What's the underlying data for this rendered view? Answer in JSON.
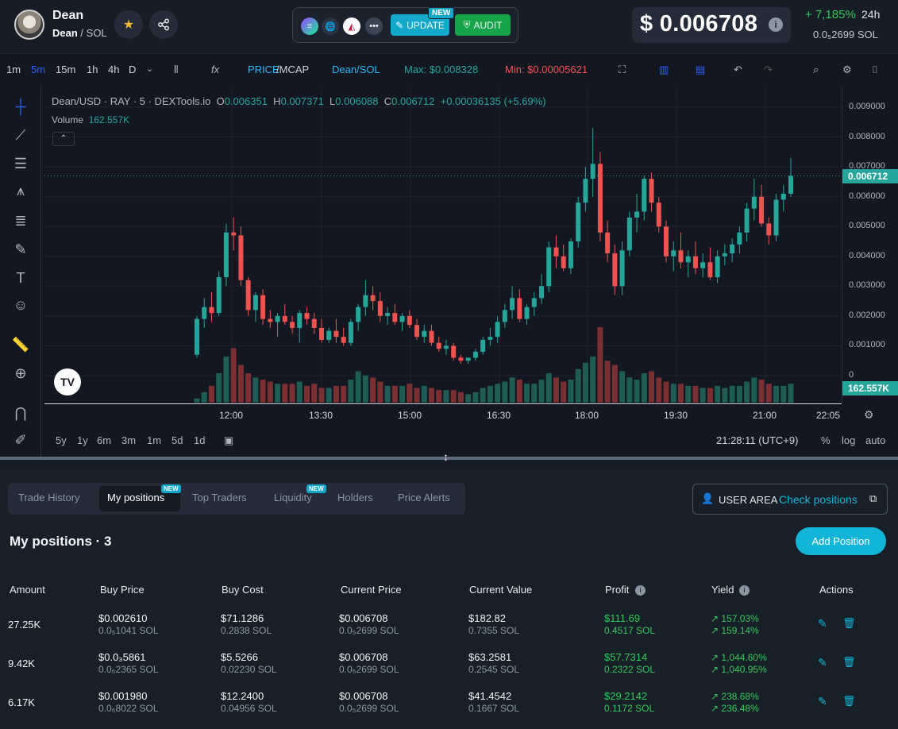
{
  "header": {
    "token_name": "Dean",
    "token_symbol": "Dean",
    "pair_quote": "/ SOL",
    "update_label": "UPDATE",
    "update_badge": "NEW",
    "audit_label": "AUDIT",
    "price": "$ 0.006708",
    "change": "+ 7,185%",
    "change_period": "24h",
    "price_sol": "0.0₅2699 SOL"
  },
  "toolbar": {
    "intervals": [
      "1m",
      "5m",
      "15m",
      "1h",
      "4h",
      "D"
    ],
    "active_interval": "5m",
    "price_label": "PRICE",
    "mcap_label": "/MCAP",
    "pair_label": "Dean/SOL",
    "max_label": "Max: $0.008328",
    "min_label": "Min: $0.00005621"
  },
  "legend": {
    "symbol": "Dean/USD · RAY · 5 · DEXTools.io",
    "o": "0.006351",
    "h": "0.007371",
    "l": "0.006088",
    "c": "0.006712",
    "change": "+0.00036135 (+5.69%)",
    "volume_label": "Volume",
    "volume_value": "162.557K"
  },
  "chart_data": {
    "type": "candlestick",
    "title": "Dean/USD · RAY · 5 · DEXTools.io",
    "y_ticks": [
      "0.009000",
      "0.008000",
      "0.007000",
      "0.006000",
      "0.005000",
      "0.004000",
      "0.003000",
      "0.002000",
      "0.001000",
      "0"
    ],
    "x_ticks": [
      "12:00",
      "13:30",
      "15:00",
      "16:30",
      "18:00",
      "19:30",
      "21:00",
      "22:05"
    ],
    "ylim": [
      0,
      0.0095
    ],
    "current_price_label": "0.006712",
    "current_volume_label": "162.557K",
    "series": [
      {
        "name": "Candles",
        "ohlc": [
          [
            0.0007,
            0.002,
            0.0006,
            0.0019
          ],
          [
            0.0019,
            0.0026,
            0.0016,
            0.0023
          ],
          [
            0.0023,
            0.0028,
            0.0018,
            0.0021
          ],
          [
            0.0021,
            0.0035,
            0.002,
            0.0033
          ],
          [
            0.0033,
            0.0051,
            0.003,
            0.0048
          ],
          [
            0.0048,
            0.0053,
            0.0042,
            0.0047
          ],
          [
            0.0047,
            0.005,
            0.003,
            0.0032
          ],
          [
            0.0032,
            0.0033,
            0.002,
            0.0022
          ],
          [
            0.0022,
            0.0028,
            0.0018,
            0.0027
          ],
          [
            0.0027,
            0.0029,
            0.0017,
            0.0019
          ],
          [
            0.0019,
            0.0022,
            0.0016,
            0.0018
          ],
          [
            0.0018,
            0.0021,
            0.0013,
            0.002
          ],
          [
            0.002,
            0.0024,
            0.0017,
            0.0018
          ],
          [
            0.0018,
            0.002,
            0.0014,
            0.0016
          ],
          [
            0.0016,
            0.0022,
            0.0011,
            0.0021
          ],
          [
            0.0021,
            0.0023,
            0.0017,
            0.0019
          ],
          [
            0.0019,
            0.0021,
            0.0014,
            0.0016
          ],
          [
            0.0016,
            0.0019,
            0.0011,
            0.0012
          ],
          [
            0.0012,
            0.0016,
            0.0011,
            0.0015
          ],
          [
            0.0015,
            0.0019,
            0.0011,
            0.0013
          ],
          [
            0.0013,
            0.0016,
            0.001,
            0.0011
          ],
          [
            0.0011,
            0.0019,
            0.001,
            0.0018
          ],
          [
            0.0018,
            0.0024,
            0.0015,
            0.0023
          ],
          [
            0.0023,
            0.0032,
            0.002,
            0.0027
          ],
          [
            0.0027,
            0.003,
            0.0022,
            0.0025
          ],
          [
            0.0025,
            0.0028,
            0.0018,
            0.002
          ],
          [
            0.002,
            0.0023,
            0.0017,
            0.0021
          ],
          [
            0.0021,
            0.0024,
            0.0017,
            0.0018
          ],
          [
            0.0018,
            0.0021,
            0.0015,
            0.002
          ],
          [
            0.002,
            0.0022,
            0.0016,
            0.0017
          ],
          [
            0.0017,
            0.0019,
            0.0012,
            0.0013
          ],
          [
            0.0013,
            0.0017,
            0.0011,
            0.0015
          ],
          [
            0.0015,
            0.0017,
            0.001,
            0.0011
          ],
          [
            0.0011,
            0.0013,
            0.0008,
            0.0009
          ],
          [
            0.0009,
            0.0012,
            0.0007,
            0.001
          ],
          [
            0.001,
            0.0011,
            0.0005,
            0.0006
          ],
          [
            0.0006,
            0.0007,
            0.0004,
            0.0005
          ],
          [
            0.0005,
            0.0006,
            0.0004,
            0.0006
          ],
          [
            0.0006,
            0.0009,
            0.0005,
            0.0008
          ],
          [
            0.0008,
            0.0013,
            0.0007,
            0.0012
          ],
          [
            0.0012,
            0.0016,
            0.001,
            0.0013
          ],
          [
            0.0013,
            0.002,
            0.0011,
            0.0018
          ],
          [
            0.0018,
            0.0024,
            0.0016,
            0.0022
          ],
          [
            0.0022,
            0.003,
            0.0019,
            0.0026
          ],
          [
            0.0026,
            0.0029,
            0.0018,
            0.0019
          ],
          [
            0.0019,
            0.0024,
            0.0017,
            0.0023
          ],
          [
            0.0023,
            0.0028,
            0.002,
            0.0026
          ],
          [
            0.0026,
            0.0034,
            0.0024,
            0.003
          ],
          [
            0.003,
            0.0045,
            0.0028,
            0.0043
          ],
          [
            0.0043,
            0.0047,
            0.0036,
            0.004
          ],
          [
            0.004,
            0.0044,
            0.0035,
            0.0036
          ],
          [
            0.0036,
            0.0046,
            0.0034,
            0.0045
          ],
          [
            0.0045,
            0.006,
            0.0043,
            0.0058
          ],
          [
            0.0058,
            0.007,
            0.0055,
            0.0066
          ],
          [
            0.0066,
            0.0083,
            0.006,
            0.0071
          ],
          [
            0.0071,
            0.0075,
            0.0045,
            0.0048
          ],
          [
            0.0048,
            0.0052,
            0.0038,
            0.0041
          ],
          [
            0.0041,
            0.0044,
            0.0027,
            0.003
          ],
          [
            0.003,
            0.0045,
            0.0027,
            0.0042
          ],
          [
            0.0042,
            0.0055,
            0.004,
            0.0053
          ],
          [
            0.0053,
            0.0061,
            0.0048,
            0.0055
          ],
          [
            0.0055,
            0.0067,
            0.0052,
            0.0066
          ],
          [
            0.0066,
            0.0068,
            0.0055,
            0.0058
          ],
          [
            0.0058,
            0.006,
            0.0048,
            0.005
          ],
          [
            0.005,
            0.0052,
            0.0038,
            0.004
          ],
          [
            0.004,
            0.0045,
            0.0035,
            0.0042
          ],
          [
            0.0042,
            0.0048,
            0.0036,
            0.0038
          ],
          [
            0.0038,
            0.0042,
            0.0033,
            0.004
          ],
          [
            0.004,
            0.0045,
            0.0034,
            0.0036
          ],
          [
            0.0036,
            0.0041,
            0.0033,
            0.0038
          ],
          [
            0.0038,
            0.0043,
            0.0032,
            0.0033
          ],
          [
            0.0033,
            0.0042,
            0.0031,
            0.004
          ],
          [
            0.004,
            0.0044,
            0.0037,
            0.0041
          ],
          [
            0.0041,
            0.0046,
            0.0038,
            0.0044
          ],
          [
            0.0044,
            0.005,
            0.0041,
            0.0048
          ],
          [
            0.0048,
            0.0058,
            0.0045,
            0.0056
          ],
          [
            0.0056,
            0.0066,
            0.0052,
            0.006
          ],
          [
            0.006,
            0.0064,
            0.005,
            0.0051
          ],
          [
            0.0051,
            0.0053,
            0.0044,
            0.0047
          ],
          [
            0.0047,
            0.0061,
            0.0045,
            0.0059
          ],
          [
            0.0059,
            0.0064,
            0.0055,
            0.0061
          ],
          [
            0.0061,
            0.0073,
            0.006,
            0.0067
          ]
        ]
      }
    ],
    "volume": [
      2,
      5,
      8,
      14,
      22,
      26,
      18,
      14,
      12,
      11,
      10,
      9,
      9,
      9,
      10,
      8,
      9,
      7,
      7,
      8,
      8,
      11,
      15,
      13,
      12,
      10,
      8,
      8,
      8,
      9,
      7,
      8,
      7,
      6,
      6,
      6,
      5,
      4,
      5,
      7,
      8,
      9,
      10,
      12,
      11,
      9,
      9,
      11,
      14,
      12,
      10,
      11,
      16,
      19,
      22,
      36,
      20,
      18,
      15,
      12,
      11,
      14,
      15,
      12,
      10,
      9,
      9,
      8,
      8,
      7,
      7,
      8,
      7,
      8,
      8,
      10,
      12,
      11,
      9,
      8,
      8,
      9
    ],
    "volume_max_label": "162.557K"
  },
  "timeframes": [
    "5y",
    "1y",
    "6m",
    "3m",
    "1m",
    "5d",
    "1d"
  ],
  "clock": "21:28:11 (UTC+9)",
  "scale_opts": [
    "%",
    "log",
    "auto"
  ],
  "tabs": [
    {
      "label": "Trade History",
      "active": false
    },
    {
      "label": "My positions",
      "active": true,
      "badge": "NEW"
    },
    {
      "label": "Top Traders",
      "active": false
    },
    {
      "label": "Liquidity",
      "active": false,
      "badge": "NEW"
    },
    {
      "label": "Holders",
      "active": false
    },
    {
      "label": "Price Alerts",
      "active": false
    }
  ],
  "user_area": {
    "label": "USER AREA",
    "link": "Check positions"
  },
  "positions": {
    "title": "My positions · 3",
    "add_label": "Add Position",
    "columns": [
      "Amount",
      "Buy Price",
      "Buy Cost",
      "Current Price",
      "Current Value",
      "Profit",
      "Yield",
      "Actions"
    ],
    "rows": [
      {
        "amount": "27.25K",
        "buy_price": "$0.002610",
        "buy_price_sol": "0.0₅1041 SOL",
        "buy_cost": "$71.1286",
        "buy_cost_sol": "0.2838 SOL",
        "cur_price": "$0.006708",
        "cur_price_sol": "0.0₅2699 SOL",
        "cur_value": "$182.82",
        "cur_value_sol": "0.7355 SOL",
        "profit": "$111.69",
        "profit_sol": "0.4517 SOL",
        "yield1": "↗ 157.03%",
        "yield2": "↗ 159.14%"
      },
      {
        "amount": "9.42K",
        "buy_price": "$0.0₃5861",
        "buy_price_sol": "0.0₆2365 SOL",
        "buy_cost": "$5.5266",
        "buy_cost_sol": "0.02230 SOL",
        "cur_price": "$0.006708",
        "cur_price_sol": "0.0₅2699 SOL",
        "cur_value": "$63.2581",
        "cur_value_sol": "0.2545 SOL",
        "profit": "$57.7314",
        "profit_sol": "0.2322 SOL",
        "yield1": "↗ 1,044.60%",
        "yield2": "↗ 1,040.95%"
      },
      {
        "amount": "6.17K",
        "buy_price": "$0.001980",
        "buy_price_sol": "0.0₆8022 SOL",
        "buy_cost": "$12.2400",
        "buy_cost_sol": "0.04956 SOL",
        "cur_price": "$0.006708",
        "cur_price_sol": "0.0₅2699 SOL",
        "cur_value": "$41.4542",
        "cur_value_sol": "0.1667 SOL",
        "profit": "$29.2142",
        "profit_sol": "0.1172 SOL",
        "yield1": "↗ 238.68%",
        "yield2": "↗ 236.48%"
      }
    ]
  },
  "colors": {
    "up": "#26a69a",
    "down": "#ef5350",
    "accent": "#13a8c9",
    "bg": "#131722"
  }
}
